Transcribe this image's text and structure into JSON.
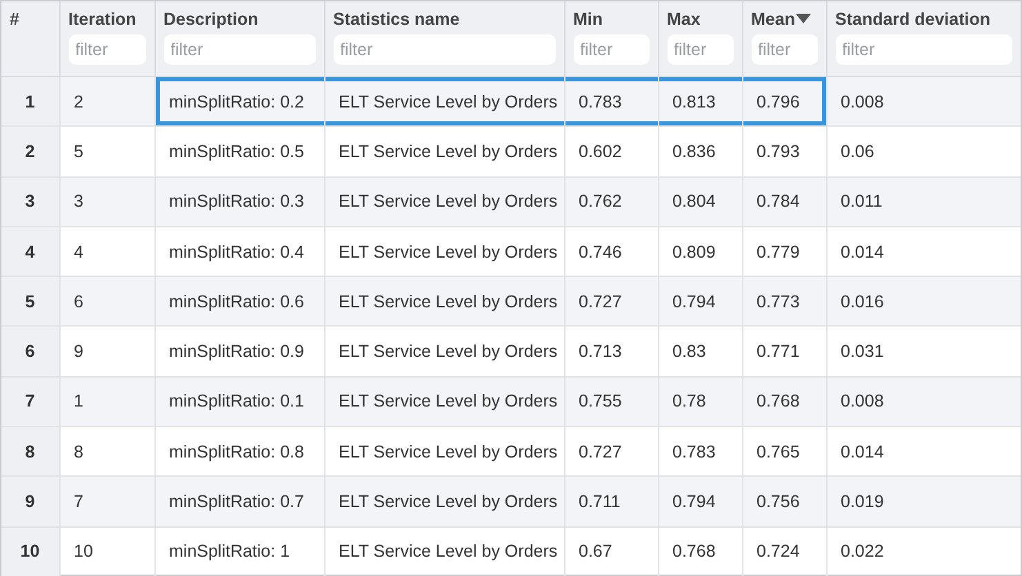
{
  "table": {
    "columns": [
      {
        "label": "#",
        "sorted_descending": false
      },
      {
        "label": "Iteration",
        "filter_placeholder": "filter",
        "sorted_descending": false
      },
      {
        "label": "Description",
        "filter_placeholder": "filter",
        "sorted_descending": false
      },
      {
        "label": "Statistics name",
        "filter_placeholder": "filter",
        "sorted_descending": false
      },
      {
        "label": "Min",
        "filter_placeholder": "filter",
        "sorted_descending": false
      },
      {
        "label": "Max",
        "filter_placeholder": "filter",
        "sorted_descending": false
      },
      {
        "label": "Mean",
        "filter_placeholder": "filter",
        "sorted_descending": true
      },
      {
        "label": "Standard deviation",
        "filter_placeholder": "filter",
        "sorted_descending": false
      }
    ],
    "rows": [
      {
        "selected": true,
        "cells": [
          "1",
          "2",
          "minSplitRatio: 0.2",
          "ELT Service Level by Orders",
          "0.783",
          "0.813",
          "0.796",
          "0.008"
        ]
      },
      {
        "selected": false,
        "cells": [
          "2",
          "5",
          "minSplitRatio: 0.5",
          "ELT Service Level by Orders",
          "0.602",
          "0.836",
          "0.793",
          "0.06"
        ]
      },
      {
        "selected": false,
        "cells": [
          "3",
          "3",
          "minSplitRatio: 0.3",
          "ELT Service Level by Orders",
          "0.762",
          "0.804",
          "0.784",
          "0.011"
        ]
      },
      {
        "selected": false,
        "cells": [
          "4",
          "4",
          "minSplitRatio: 0.4",
          "ELT Service Level by Orders",
          "0.746",
          "0.809",
          "0.779",
          "0.014"
        ]
      },
      {
        "selected": false,
        "cells": [
          "5",
          "6",
          "minSplitRatio: 0.6",
          "ELT Service Level by Orders",
          "0.727",
          "0.794",
          "0.773",
          "0.016"
        ]
      },
      {
        "selected": false,
        "cells": [
          "6",
          "9",
          "minSplitRatio: 0.9",
          "ELT Service Level by Orders",
          "0.713",
          "0.83",
          "0.771",
          "0.031"
        ]
      },
      {
        "selected": false,
        "cells": [
          "7",
          "1",
          "minSplitRatio: 0.1",
          "ELT Service Level by Orders",
          "0.755",
          "0.78",
          "0.768",
          "0.008"
        ]
      },
      {
        "selected": false,
        "cells": [
          "8",
          "8",
          "minSplitRatio: 0.8",
          "ELT Service Level by Orders",
          "0.727",
          "0.783",
          "0.765",
          "0.014"
        ]
      },
      {
        "selected": false,
        "cells": [
          "9",
          "7",
          "minSplitRatio: 0.7",
          "ELT Service Level by Orders",
          "0.711",
          "0.794",
          "0.756",
          "0.019"
        ]
      },
      {
        "selected": false,
        "cells": [
          "10",
          "10",
          "minSplitRatio: 1",
          "ELT Service Level by Orders",
          "0.67",
          "0.768",
          "0.724",
          "0.022"
        ]
      }
    ]
  }
}
